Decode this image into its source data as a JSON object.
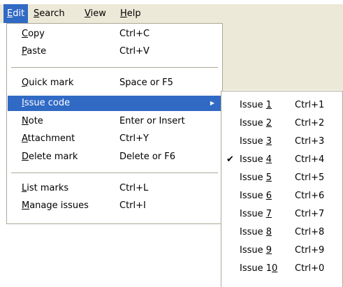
{
  "menubar": {
    "items": [
      {
        "prefix": "",
        "key": "E",
        "rest": "dit"
      },
      {
        "prefix": "",
        "key": "S",
        "rest": "earch"
      },
      {
        "prefix": "",
        "key": "V",
        "rest": "iew"
      },
      {
        "prefix": "",
        "key": "H",
        "rest": "elp"
      }
    ]
  },
  "edit_menu": {
    "items": [
      {
        "prefix": "",
        "key": "C",
        "rest": "opy",
        "shortcut": "Ctrl+C"
      },
      {
        "prefix": "",
        "key": "P",
        "rest": "aste",
        "shortcut": "Ctrl+V"
      },
      {
        "prefix": "",
        "key": "Q",
        "rest": "uick mark",
        "shortcut": "Space or F5"
      },
      {
        "prefix": "",
        "key": "I",
        "rest": "ssue code",
        "shortcut": ""
      },
      {
        "prefix": "",
        "key": "N",
        "rest": "ote",
        "shortcut": "Enter or Insert"
      },
      {
        "prefix": "",
        "key": "A",
        "rest": "ttachment",
        "shortcut": "Ctrl+Y"
      },
      {
        "prefix": "",
        "key": "D",
        "rest": "elete mark",
        "shortcut": "Delete or F6"
      },
      {
        "prefix": "",
        "key": "L",
        "rest": "ist marks",
        "shortcut": "Ctrl+L"
      },
      {
        "prefix": "",
        "key": "M",
        "rest": "anage issues",
        "shortcut": "Ctrl+I"
      }
    ],
    "submenu_arrow": "▶"
  },
  "issue_submenu": {
    "check_mark": "✔",
    "items": [
      {
        "prefix": "Issue ",
        "key": "1",
        "rest": "",
        "shortcut": "Ctrl+1"
      },
      {
        "prefix": "Issue ",
        "key": "2",
        "rest": "",
        "shortcut": "Ctrl+2"
      },
      {
        "prefix": "Issue ",
        "key": "3",
        "rest": "",
        "shortcut": "Ctrl+3"
      },
      {
        "prefix": "Issue ",
        "key": "4",
        "rest": "",
        "shortcut": "Ctrl+4"
      },
      {
        "prefix": "Issue ",
        "key": "5",
        "rest": "",
        "shortcut": "Ctrl+5"
      },
      {
        "prefix": "Issue ",
        "key": "6",
        "rest": "",
        "shortcut": "Ctrl+6"
      },
      {
        "prefix": "Issue ",
        "key": "7",
        "rest": "",
        "shortcut": "Ctrl+7"
      },
      {
        "prefix": "Issue ",
        "key": "8",
        "rest": "",
        "shortcut": "Ctrl+8"
      },
      {
        "prefix": "Issue ",
        "key": "9",
        "rest": "",
        "shortcut": "Ctrl+9"
      },
      {
        "prefix": "Issue 1",
        "key": "0",
        "rest": "",
        "shortcut": "Ctrl+0"
      }
    ]
  },
  "colors": {
    "highlight": "#316ac5",
    "menubar_background": "#ece9d8",
    "menu_border": "#aca899"
  }
}
